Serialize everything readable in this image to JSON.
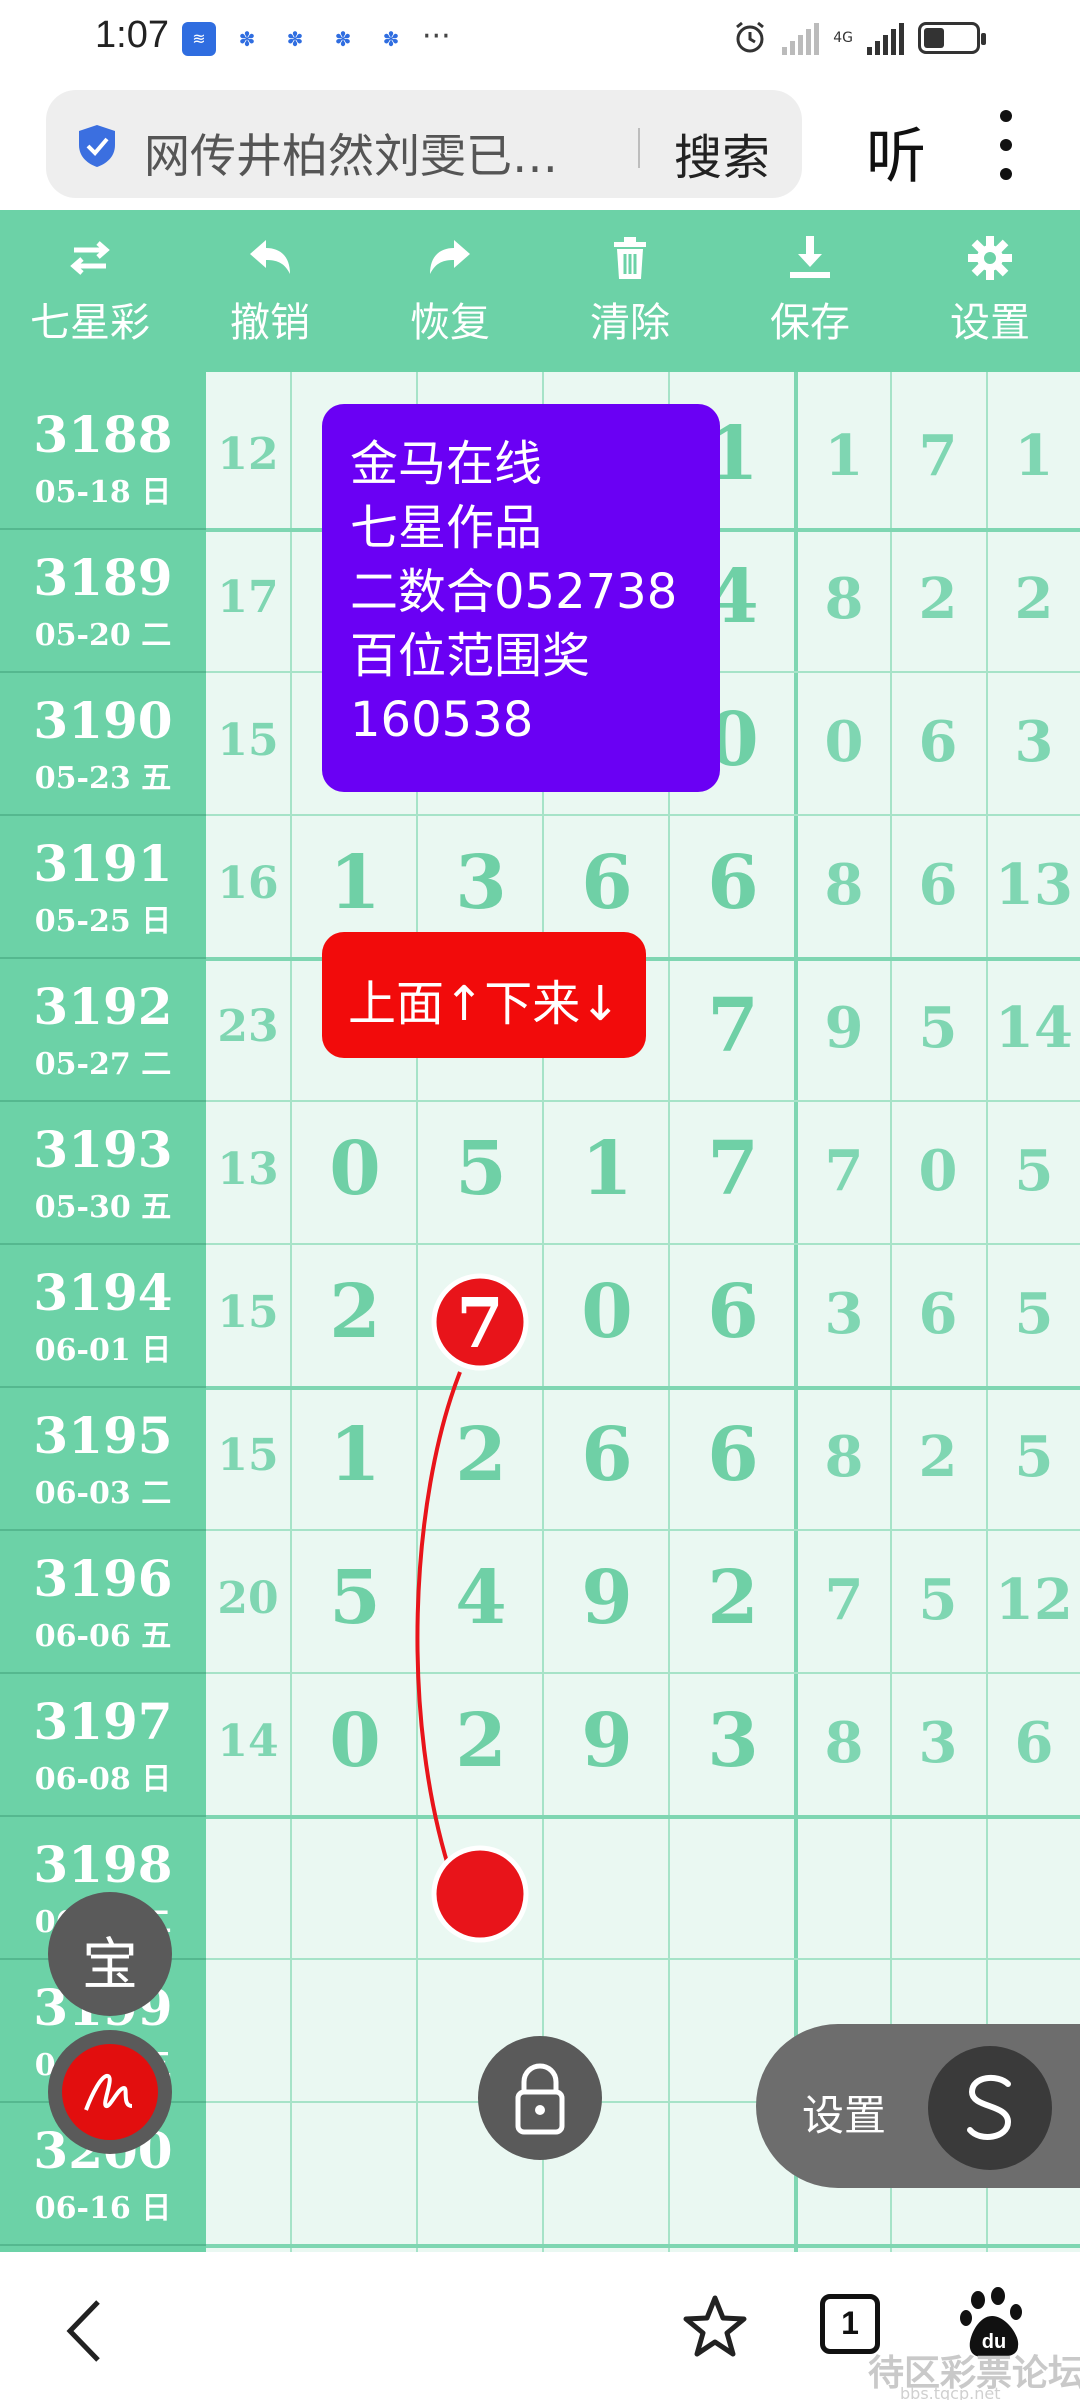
{
  "status_bar": {
    "time": "1:07",
    "more_indicator": "···",
    "network_label": "4G",
    "icons": [
      "app-icon",
      "baidu-paw-icon",
      "baidu-paw-icon",
      "baidu-paw-icon",
      "baidu-paw-icon",
      "alarm-icon",
      "signal-icon",
      "signal-icon",
      "battery-icon"
    ]
  },
  "address_bar": {
    "query": "网传井柏然刘雯已…",
    "search_label": "搜索",
    "listen_label": "听"
  },
  "toolbar": {
    "items": [
      {
        "label": "七星彩",
        "icon": "swap-icon"
      },
      {
        "label": "撤销",
        "icon": "undo-icon"
      },
      {
        "label": "恢复",
        "icon": "redo-icon"
      },
      {
        "label": "清除",
        "icon": "trash-icon"
      },
      {
        "label": "保存",
        "icon": "download-icon"
      },
      {
        "label": "设置",
        "icon": "gear-icon"
      }
    ]
  },
  "rows": [
    {
      "issue": "3188",
      "date": "05-18 日",
      "sum": "12",
      "digits": [
        "",
        "",
        "",
        "1"
      ],
      "extra": [
        "1",
        "7",
        "1"
      ]
    },
    {
      "issue": "3189",
      "date": "05-20 二",
      "sum": "17",
      "digits": [
        "",
        "",
        "",
        "4"
      ],
      "extra": [
        "8",
        "2",
        "2"
      ]
    },
    {
      "issue": "3190",
      "date": "05-23 五",
      "sum": "15",
      "digits": [
        "",
        "",
        "",
        "0"
      ],
      "extra": [
        "0",
        "6",
        "3"
      ]
    },
    {
      "issue": "3191",
      "date": "05-25 日",
      "sum": "16",
      "digits": [
        "1",
        "3",
        "6",
        "6"
      ],
      "extra": [
        "8",
        "6",
        "13"
      ]
    },
    {
      "issue": "3192",
      "date": "05-27 二",
      "sum": "23",
      "digits": [
        "",
        "",
        "",
        "7"
      ],
      "extra": [
        "9",
        "5",
        "14"
      ]
    },
    {
      "issue": "3193",
      "date": "05-30 五",
      "sum": "13",
      "digits": [
        "0",
        "5",
        "1",
        "7"
      ],
      "extra": [
        "7",
        "0",
        "5"
      ]
    },
    {
      "issue": "3194",
      "date": "06-01 日",
      "sum": "15",
      "digits": [
        "2",
        "",
        "0",
        "6"
      ],
      "extra": [
        "3",
        "6",
        "5"
      ]
    },
    {
      "issue": "3195",
      "date": "06-03 二",
      "sum": "15",
      "digits": [
        "1",
        "2",
        "6",
        "6"
      ],
      "extra": [
        "8",
        "2",
        "5"
      ]
    },
    {
      "issue": "3196",
      "date": "06-06 五",
      "sum": "20",
      "digits": [
        "5",
        "4",
        "9",
        "2"
      ],
      "extra": [
        "7",
        "5",
        "12"
      ]
    },
    {
      "issue": "3197",
      "date": "06-08 日",
      "sum": "14",
      "digits": [
        "0",
        "2",
        "9",
        "3"
      ],
      "extra": [
        "8",
        "3",
        "6"
      ]
    },
    {
      "issue": "3198",
      "date": "06-10 二",
      "sum": "",
      "digits": [
        "",
        "",
        "",
        ""
      ],
      "extra": [
        "",
        "",
        ""
      ]
    },
    {
      "issue": "3199",
      "date": "06-13 五",
      "sum": "",
      "digits": [
        "",
        "",
        "",
        ""
      ],
      "extra": [
        "",
        "",
        ""
      ]
    },
    {
      "issue": "3200",
      "date": "06-16 日",
      "sum": "",
      "digits": [
        "",
        "",
        "",
        ""
      ],
      "extra": [
        "",
        "",
        ""
      ]
    }
  ],
  "annotation_card": {
    "lines": [
      "金马在线",
      "七星作品",
      "二数合052738",
      "百位范围奖",
      "160538"
    ],
    "color": "#6a00f4"
  },
  "direction_tag": {
    "text": "上面↑下来↓",
    "color": "#f20b0b"
  },
  "marker": {
    "number": "7",
    "color": "#e8141a"
  },
  "floating": {
    "bao_label": "宝",
    "settings_label": "设置",
    "settings_icon": "s-curve-icon",
    "lock_icon": "lock-icon",
    "pen_icon": "pen-icon"
  },
  "bottom_nav": {
    "tab_count": "1",
    "icons": [
      "back-icon",
      "star-icon",
      "tabs-icon",
      "baidu-icon"
    ]
  },
  "watermark": {
    "text": "待区彩票论坛",
    "sub": "bbs.tqcp.net"
  },
  "colors": {
    "accent_green": "#6cd2a7",
    "digit_green": "#6fd0a6",
    "grid_bg": "#eaf8f2"
  }
}
